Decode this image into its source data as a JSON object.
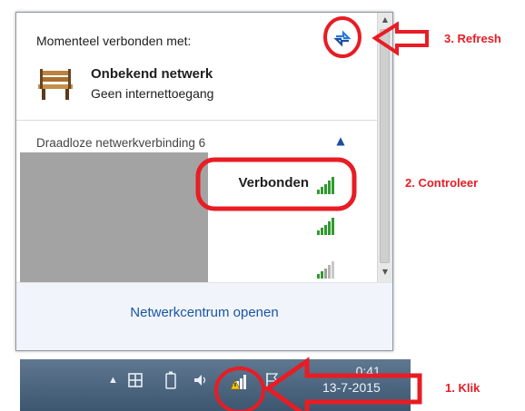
{
  "flyout": {
    "connected_header": "Momenteel verbonden met:",
    "network": {
      "name": "Onbekend netwerk",
      "status": "Geen internettoegang",
      "icon": "bench-icon"
    },
    "section_title": "Draadloze netwerkverbinding 6",
    "connected_label": "Verbonden",
    "footer_link": "Netwerkcentrum openen"
  },
  "taskbar": {
    "clock_time": "0:41",
    "clock_date": "13-7-2015"
  },
  "annotations": {
    "step1": "1. Klik",
    "step2": "2. Controleer",
    "step3": "3. Refresh",
    "color": "#e81c24"
  }
}
